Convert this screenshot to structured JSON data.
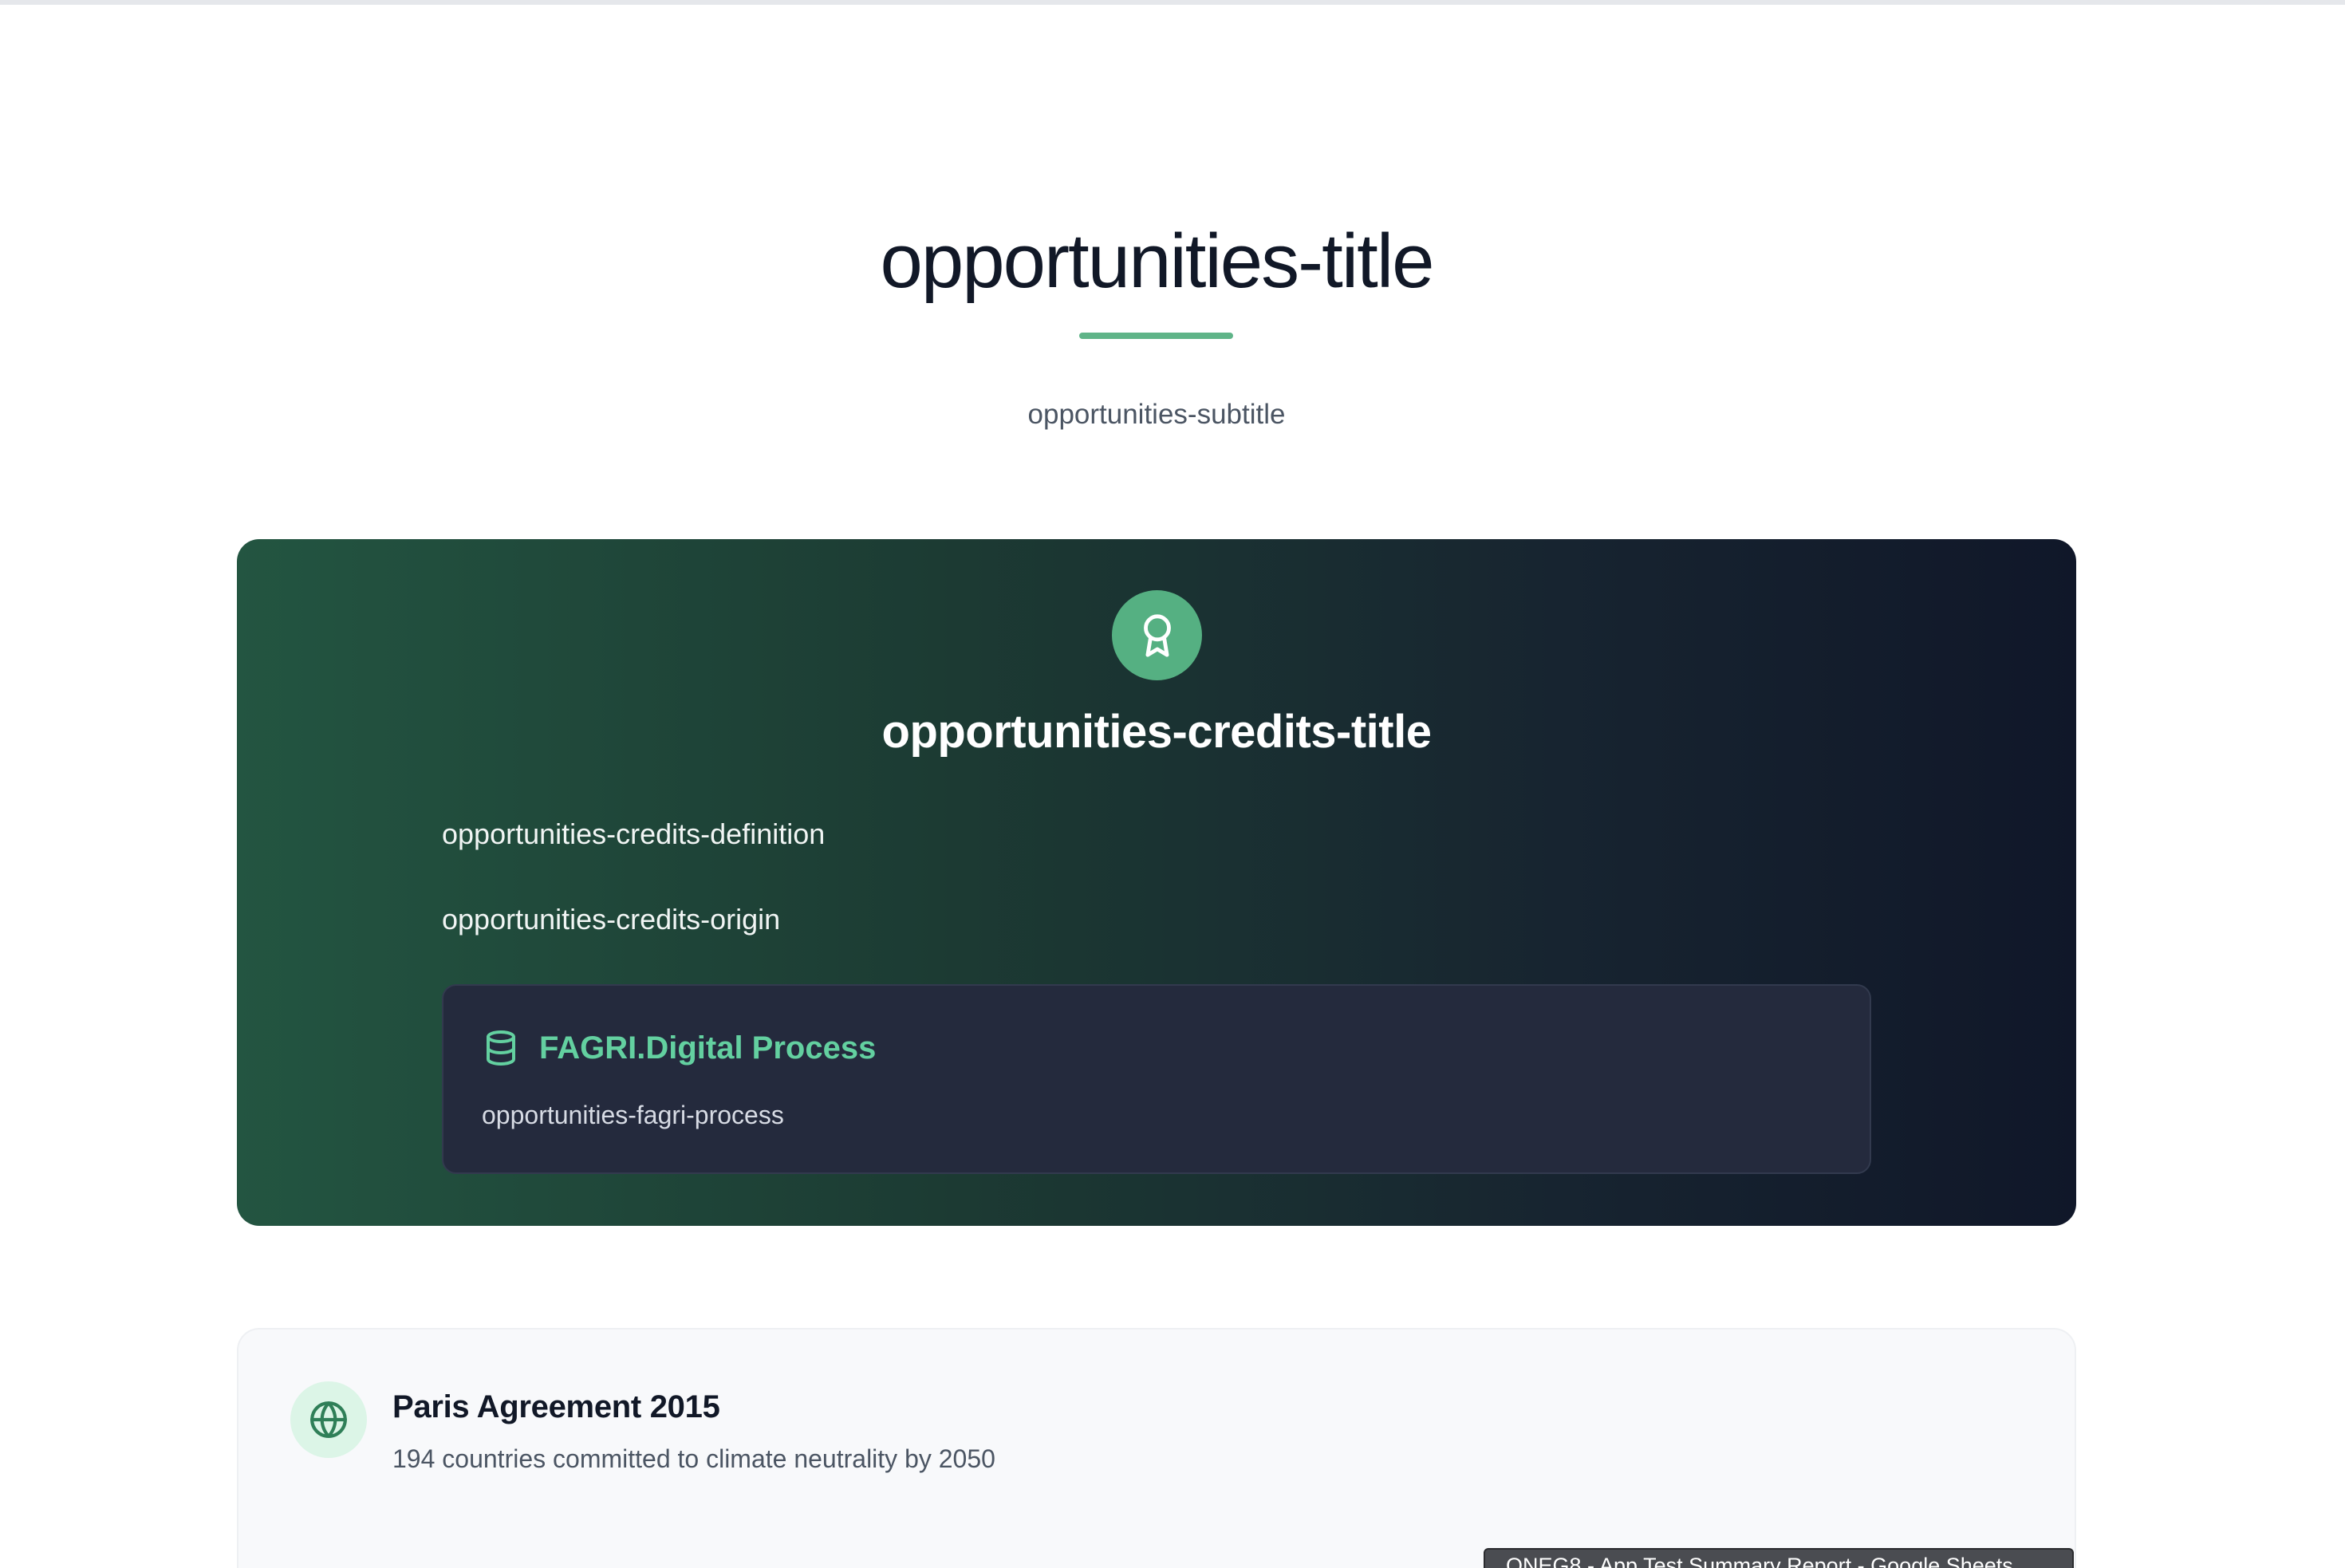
{
  "header": {
    "title": "opportunities-title",
    "subtitle": "opportunities-subtitle"
  },
  "credits": {
    "icon": "award-icon",
    "title": "opportunities-credits-title",
    "definition": "opportunities-credits-definition",
    "origin": "opportunities-credits-origin",
    "process": {
      "icon": "database-icon",
      "title": "FAGRI.Digital Process",
      "text": "opportunities-fagri-process"
    }
  },
  "paris": {
    "icon": "globe-icon",
    "title": "Paris Agreement 2015",
    "description": "194 countries committed to climate neutrality by 2050"
  },
  "tooltip": {
    "text": "ONEG8 - App Test Summary Report - Google Sheets"
  },
  "colors": {
    "accent": "#5fb488",
    "process_title": "#63d0a0",
    "card_gradient_start": "#235541",
    "card_gradient_end": "#101729"
  }
}
